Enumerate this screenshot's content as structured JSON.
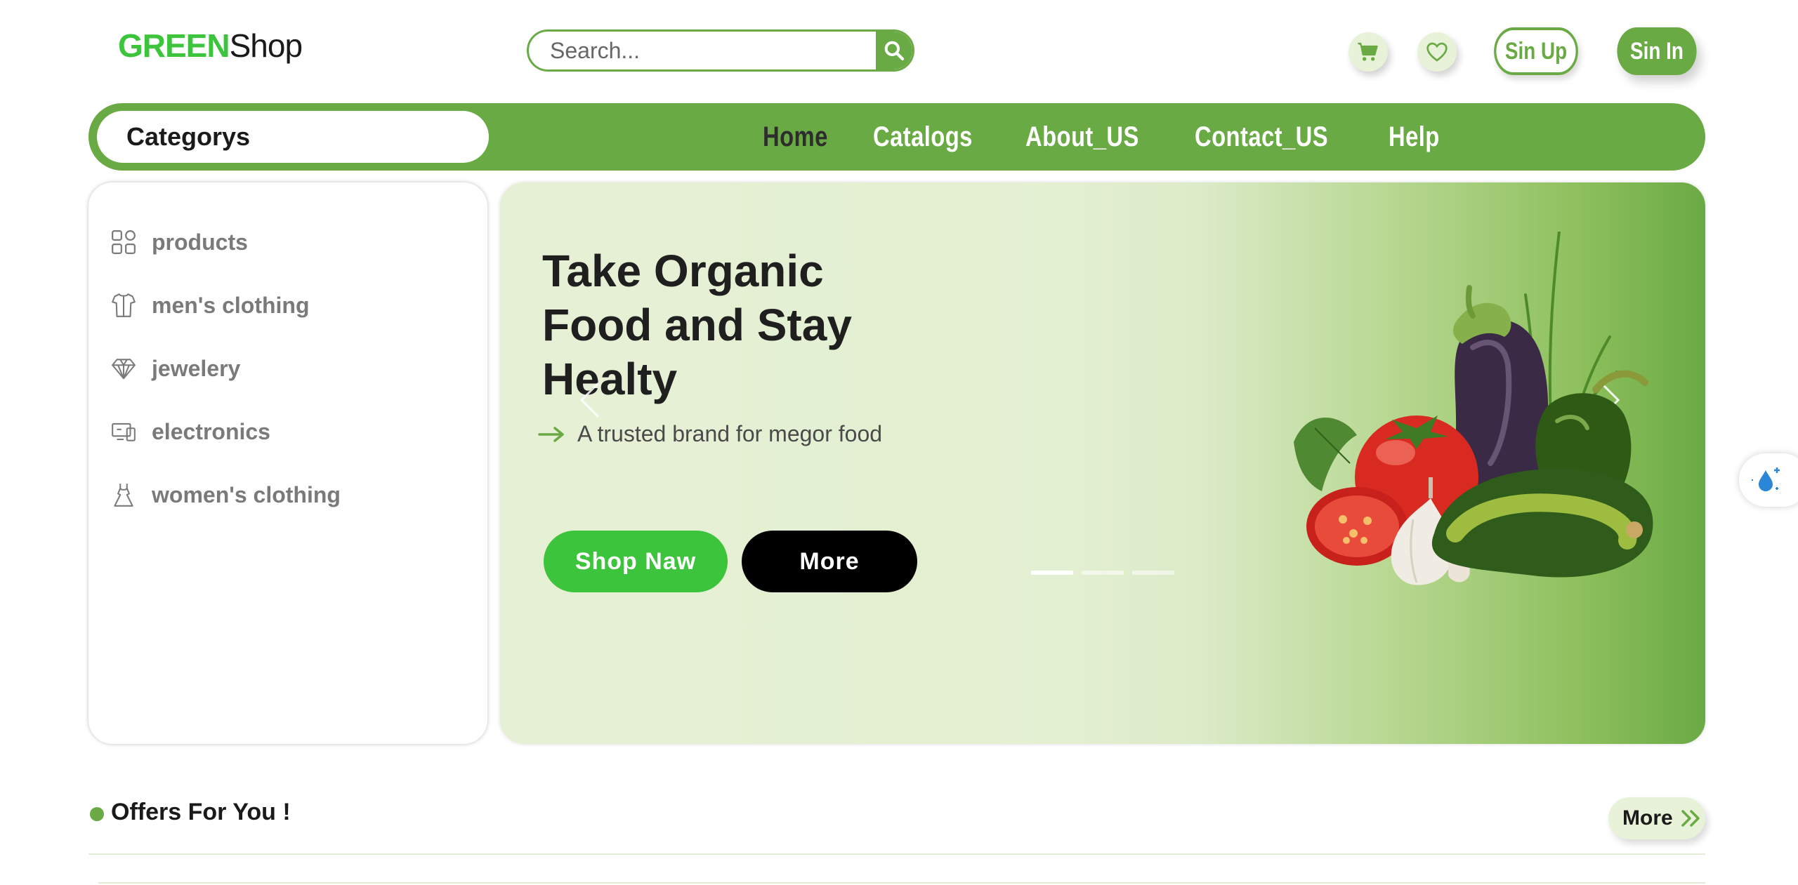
{
  "header": {
    "logo_green": "GREEN",
    "logo_shop": "Shop",
    "search_placeholder": "Search...",
    "signup_label": "Sin Up",
    "signin_label": "Sin In"
  },
  "nav": {
    "categories_label": "Categorys",
    "links": [
      {
        "label": "Home",
        "active": true
      },
      {
        "label": "Catalogs",
        "active": false
      },
      {
        "label": "About_US",
        "active": false
      },
      {
        "label": "Contact_US",
        "active": false
      },
      {
        "label": "Help",
        "active": false
      }
    ]
  },
  "sidebar": {
    "items": [
      {
        "label": "products",
        "icon": "grid-icon"
      },
      {
        "label": "men's clothing",
        "icon": "shirt-icon"
      },
      {
        "label": "jewelery",
        "icon": "diamond-icon"
      },
      {
        "label": "electronics",
        "icon": "devices-icon"
      },
      {
        "label": "women's clothing",
        "icon": "dress-icon"
      }
    ]
  },
  "hero": {
    "title_lines": [
      "Take Organic",
      "Food and Stay",
      "Healty"
    ],
    "subtitle": "A trusted brand for megor food",
    "shop_button": "Shop Naw",
    "more_button": "More",
    "slides_total": 3,
    "active_slide": 1
  },
  "offers": {
    "title": "Offers For You !",
    "more_button": "More"
  },
  "colors": {
    "brand_green": "#6aaa44",
    "bright_green": "#3cc43c",
    "light_green": "#e7f2d8"
  }
}
